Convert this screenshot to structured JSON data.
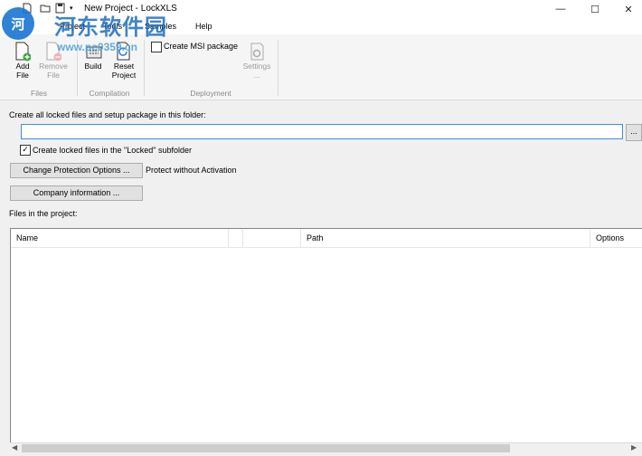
{
  "titlebar": {
    "title": "New Project - LockXLS",
    "minimize": "—",
    "maximize": "☐",
    "close": "✕"
  },
  "watermark": {
    "logo": "河",
    "text": "河东软件园",
    "url": "www.pc0359.cn"
  },
  "menu": [
    "Project",
    "Tools",
    "Samples",
    "Help"
  ],
  "ribbon": {
    "add_file": [
      "Add",
      "File"
    ],
    "remove_file": [
      "Remove",
      "File"
    ],
    "build": "Build",
    "reset_project": [
      "Reset",
      "Project"
    ],
    "create_msi_label": "Create MSI package",
    "settings": [
      "Settings",
      "..."
    ],
    "groups": {
      "files": "Files",
      "compilation": "Compilation",
      "deployment": "Deployment"
    }
  },
  "form": {
    "folder_label": "Create all locked files and setup package in this folder:",
    "folder_value": "",
    "browse_label": "...",
    "locked_subfolder_label": "Create locked files in the \"Locked\" subfolder",
    "locked_subfolder_checked": true,
    "change_protection_label": "Change Protection Options ...",
    "protection_status": "Protect without Activation",
    "company_info_label": "Company information ...",
    "files_label": "Files in the project:"
  },
  "list": {
    "columns": [
      "Name",
      "",
      "",
      "Path",
      "Options"
    ],
    "rows": []
  }
}
